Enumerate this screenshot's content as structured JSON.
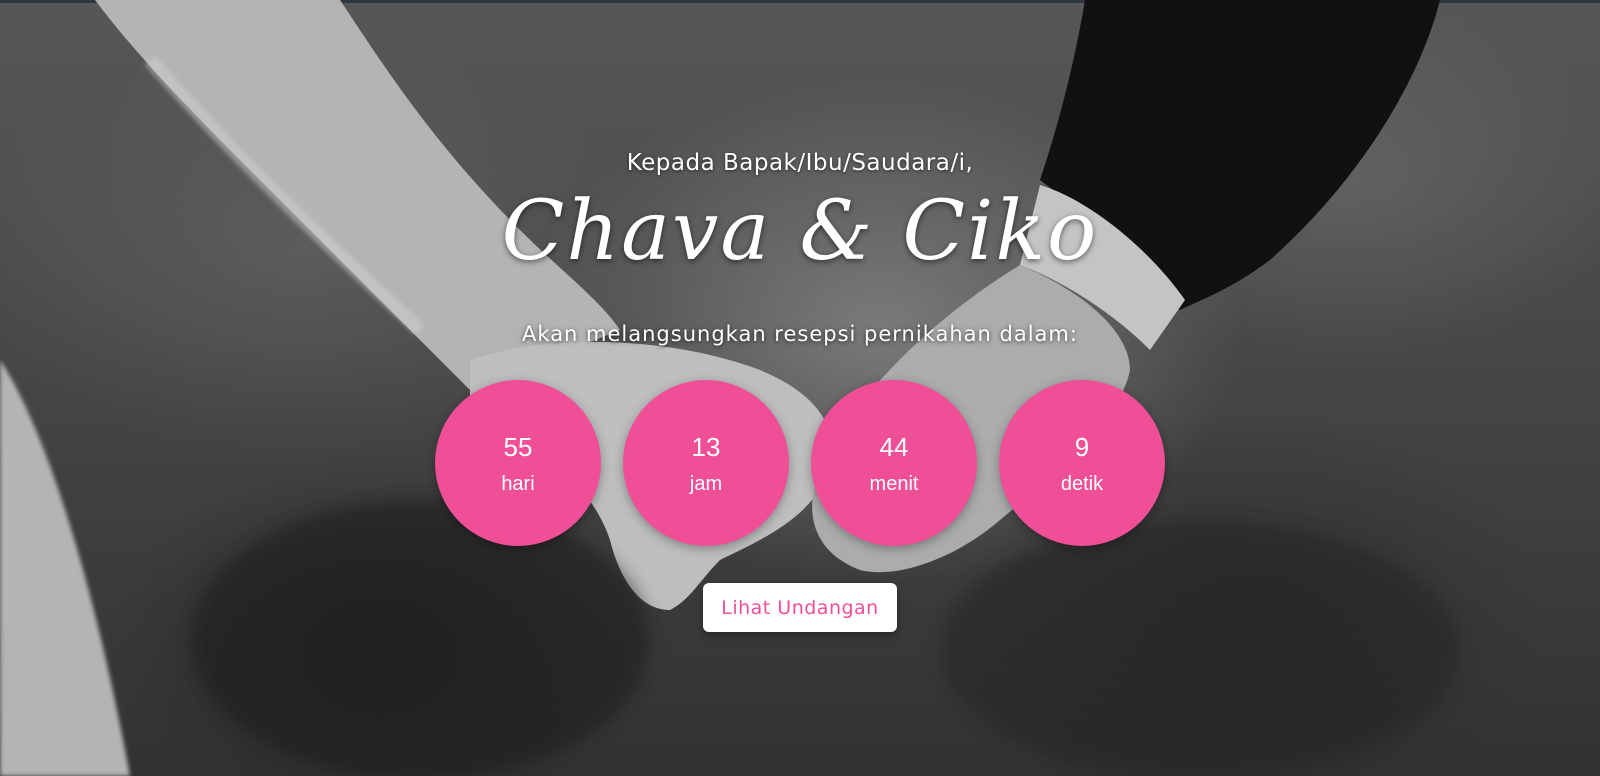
{
  "hero": {
    "background_image": "black-and-white photo of bride and groom holding hands",
    "greeting": "Kepada Bapak/Ibu/Saudara/i,",
    "couple_names": "Chava & Ciko",
    "subtitle": "Akan melangsungkan resepsi pernikahan dalam:"
  },
  "countdown": {
    "days": {
      "value": "55",
      "label": "hari"
    },
    "hours": {
      "value": "13",
      "label": "jam"
    },
    "minutes": {
      "value": "44",
      "label": "menit"
    },
    "seconds": {
      "value": "9",
      "label": "detik"
    }
  },
  "button": {
    "label": "Lihat Undangan"
  },
  "colors": {
    "accent_pink": "#ef4f97",
    "text_white": "#ffffff",
    "button_bg": "#ffffff"
  }
}
